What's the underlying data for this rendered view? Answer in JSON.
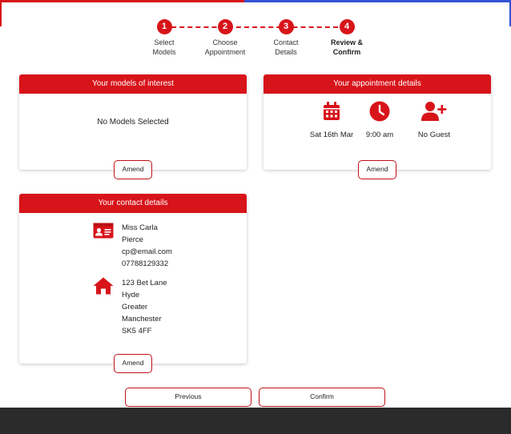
{
  "stepper": {
    "steps": [
      {
        "num": "1",
        "line1": "Select",
        "line2": "Models"
      },
      {
        "num": "2",
        "line1": "Choose",
        "line2": "Appointment"
      },
      {
        "num": "3",
        "line1": "Contact",
        "line2": "Details"
      },
      {
        "num": "4",
        "line1": "Review &",
        "line2": "Confirm"
      }
    ],
    "active_step": 4
  },
  "models": {
    "title": "Your models of interest",
    "empty_text": "No Models Selected",
    "amend_label": "Amend"
  },
  "appointment": {
    "title": "Your appointment details",
    "date": "Sat 16th Mar",
    "time": "9:00 am",
    "guest": "No Guest",
    "amend_label": "Amend",
    "icons": [
      "calendar-icon",
      "clock-icon",
      "add-user-icon"
    ]
  },
  "contact": {
    "title": "Your contact details",
    "name_line1": "Miss Carla",
    "name_line2": "Pierce",
    "email": "cp@email.com",
    "phone": "07788129332",
    "address": [
      "123 Bet Lane",
      "Hyde",
      "Greater",
      "Manchester",
      "SK5 4FF"
    ],
    "amend_label": "Amend",
    "icons": [
      "id-card-icon",
      "home-icon"
    ]
  },
  "actions": {
    "previous_label": "Previous",
    "confirm_label": "Confirm"
  },
  "colors": {
    "accent_red": "#d7141a",
    "accent_blue": "#3452d6",
    "footer_dark": "#2b2b2b"
  }
}
